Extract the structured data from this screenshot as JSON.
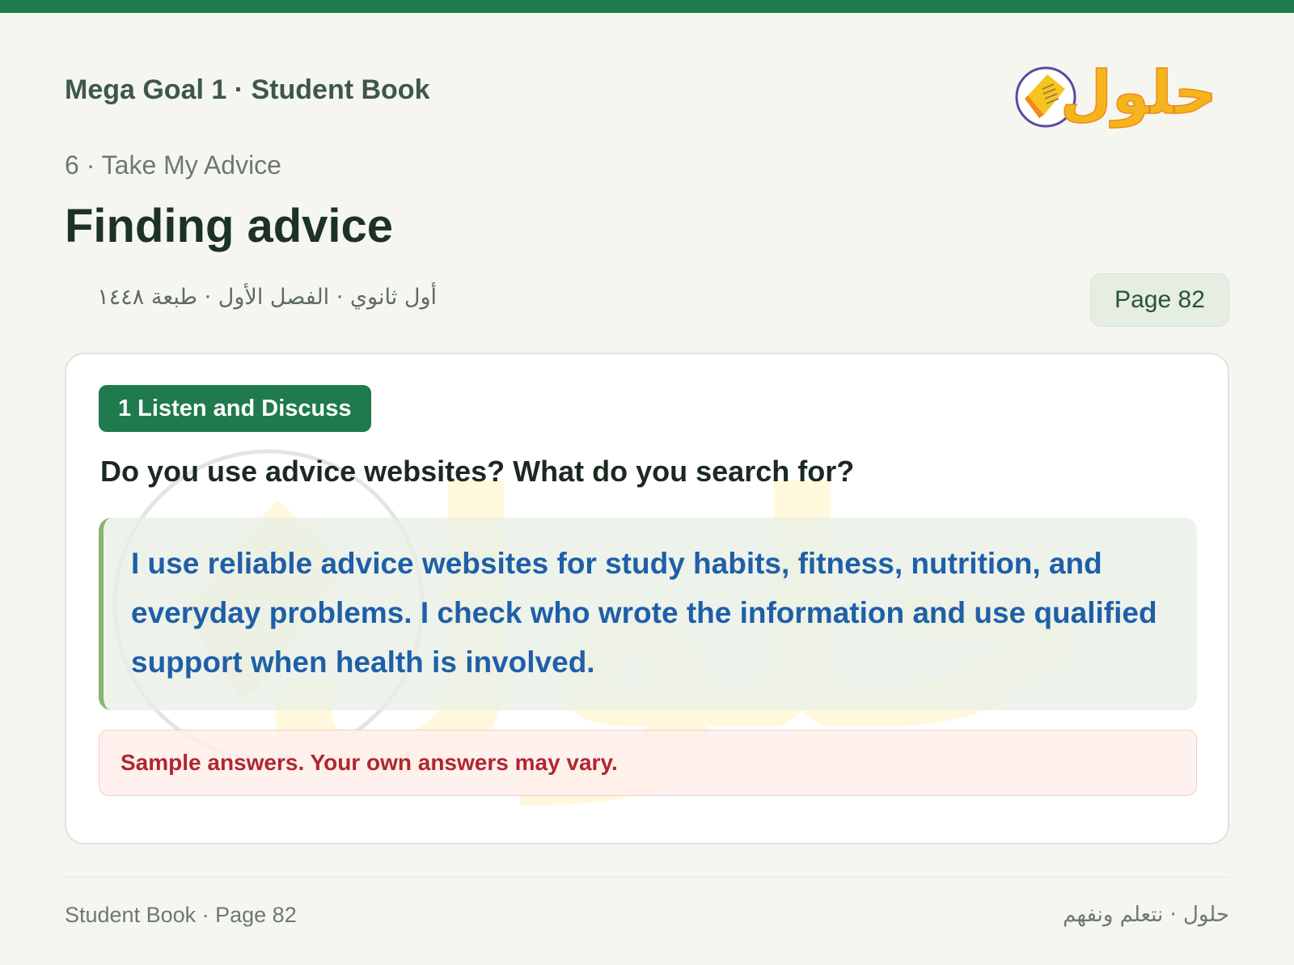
{
  "header": {
    "book_title": "Mega Goal 1 · Student Book",
    "unit_line": "6 · Take My Advice",
    "lesson_title": "Finding advice",
    "edition_line": "أول ثانوي · الفصل الأول · طبعة ١٤٤٨",
    "page_chip": "Page 82"
  },
  "logo": {
    "wordmark": "حلول",
    "icon": "book-icon",
    "colors": {
      "yellow": "#f7c31f",
      "orange": "#ef8a1d",
      "ring": "#5a4aa0"
    }
  },
  "card": {
    "section_tag": "1 Listen and Discuss",
    "question": "Do you use advice websites? What do you search for?",
    "answer": "I use reliable advice websites for study habits, fitness, nutrition, and everyday problems. I check who wrote the information and use qualified support when health is involved.",
    "note": "Sample answers. Your own answers may vary."
  },
  "footer": {
    "left": "Student Book · Page 82",
    "right": "حلول · نتعلم ونفهم"
  },
  "colors": {
    "accent_green": "#1f7a4d",
    "answer_blue": "#1f5fa8",
    "note_red": "#b02630",
    "page_bg": "#f6f6f0"
  }
}
